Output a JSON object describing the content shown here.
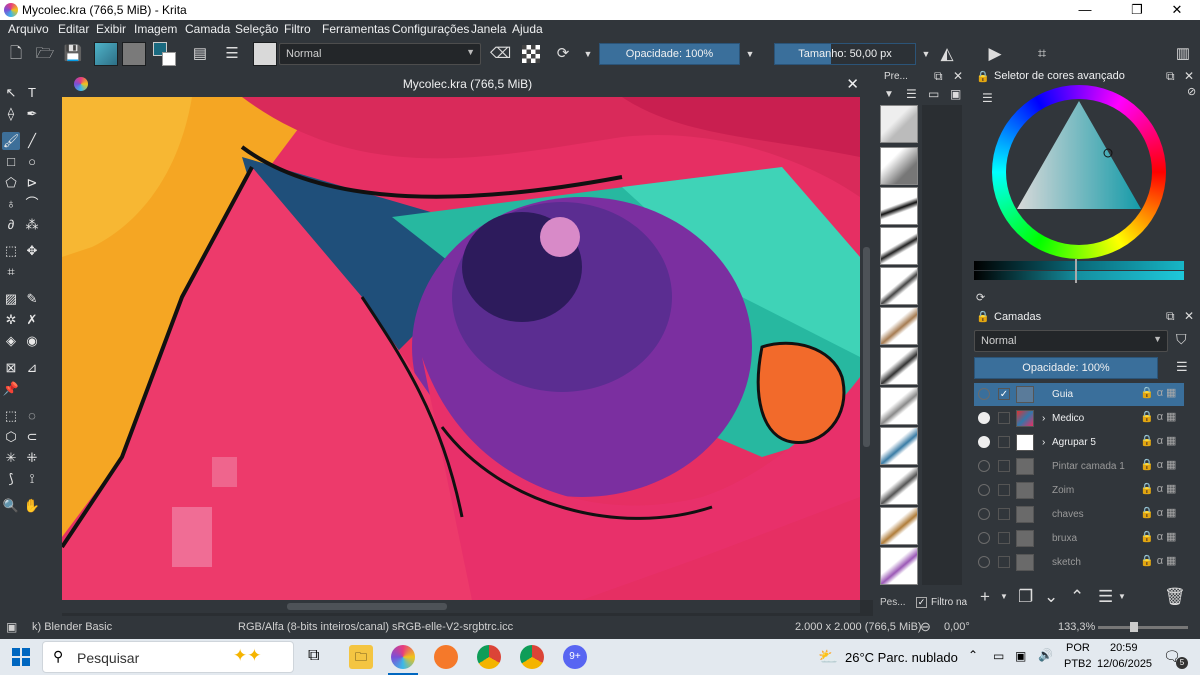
{
  "window": {
    "title": "Mycolec.kra (766,5 MiB)  - Krita",
    "minimize": "—",
    "maximize": "❐",
    "close": "✕"
  },
  "menu": [
    "Arquivo",
    "Editar",
    "Exibir",
    "Imagem",
    "Camada",
    "Seleção",
    "Filtro",
    "Ferramentas",
    "Configurações",
    "Janela",
    "Ajuda"
  ],
  "toolbar": {
    "blend_mode": "Normal",
    "opacity": "Opacidade: 100%",
    "size": "Tamanho: 50,00 px"
  },
  "document": {
    "title": "Mycolec.kra (766,5 MiB)",
    "close": "✕"
  },
  "presets": {
    "title": "Pre...",
    "search_label": "Pes...",
    "filter_label": "Filtro na"
  },
  "color_selector": {
    "title": "Seletor de cores avançado",
    "accent": "#3a6f9b"
  },
  "layers": {
    "title": "Camadas",
    "blend_mode": "Normal",
    "opacity": "Opacidade:  100%",
    "items": [
      {
        "name": "Guia",
        "visible": false,
        "checked": true
      },
      {
        "name": "Medico",
        "visible": true,
        "checked": false
      },
      {
        "name": "Agrupar  5",
        "visible": true,
        "checked": false
      },
      {
        "name": "Pintar camada 1",
        "visible": false,
        "checked": false
      },
      {
        "name": "Zoim",
        "visible": false,
        "checked": false
      },
      {
        "name": "chaves",
        "visible": false,
        "checked": false
      },
      {
        "name": "bruxa",
        "visible": false,
        "checked": false
      },
      {
        "name": "sketch",
        "visible": false,
        "checked": false
      }
    ]
  },
  "status": {
    "brush": "k) Blender Basic",
    "color_space": "RGB/Alfa (8-bits inteiros/canal)  sRGB-elle-V2-srgbtrc.icc",
    "dimensions": "2.000 x 2.000 (766,5 MiB)",
    "rotation": "0,00°",
    "zoom": "133,3%"
  },
  "taskbar": {
    "search_placeholder": "Pesquisar",
    "weather": "26°C  Parc. nublado",
    "lang_top": "POR",
    "lang_bottom": "PTB2",
    "time": "20:59",
    "date": "12/06/2025",
    "notif_count": "5"
  }
}
